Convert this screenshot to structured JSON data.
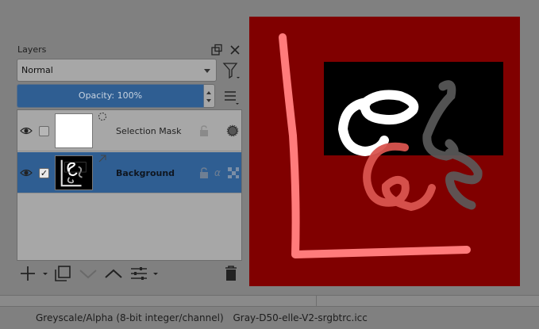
{
  "docker": {
    "title": "Layers",
    "float_icon": "float-icon",
    "close_icon": "close-icon"
  },
  "blend_mode": {
    "value": "Normal"
  },
  "opacity": {
    "label": "Opacity:  100%",
    "value_percent": 100
  },
  "layers": [
    {
      "name": "Selection Mask",
      "visible": true,
      "checked": false,
      "selected": false,
      "thumb": "white",
      "status_icon": "selection-icon"
    },
    {
      "name": "Background",
      "visible": true,
      "checked": true,
      "selected": true,
      "thumb": "drawing",
      "status_icon": "alpha-channel-icon"
    }
  ],
  "toolbar": {
    "icons": [
      "add-layer-icon",
      "duplicate-layer-icon",
      "move-down-icon",
      "move-up-icon",
      "layer-properties-icon",
      "delete-layer-icon"
    ]
  },
  "canvas": {
    "background_color": "#800000",
    "inner_rect_color": "#000000"
  },
  "status_bar": {
    "color_space": "Greyscale/Alpha (8-bit integer/channel)",
    "profile": "Gray-D50-elle-V2-srgbtrc.icc"
  },
  "colors": {
    "accent": "#2f5e92",
    "panel": "#a7a7a7",
    "background": "#808080"
  }
}
